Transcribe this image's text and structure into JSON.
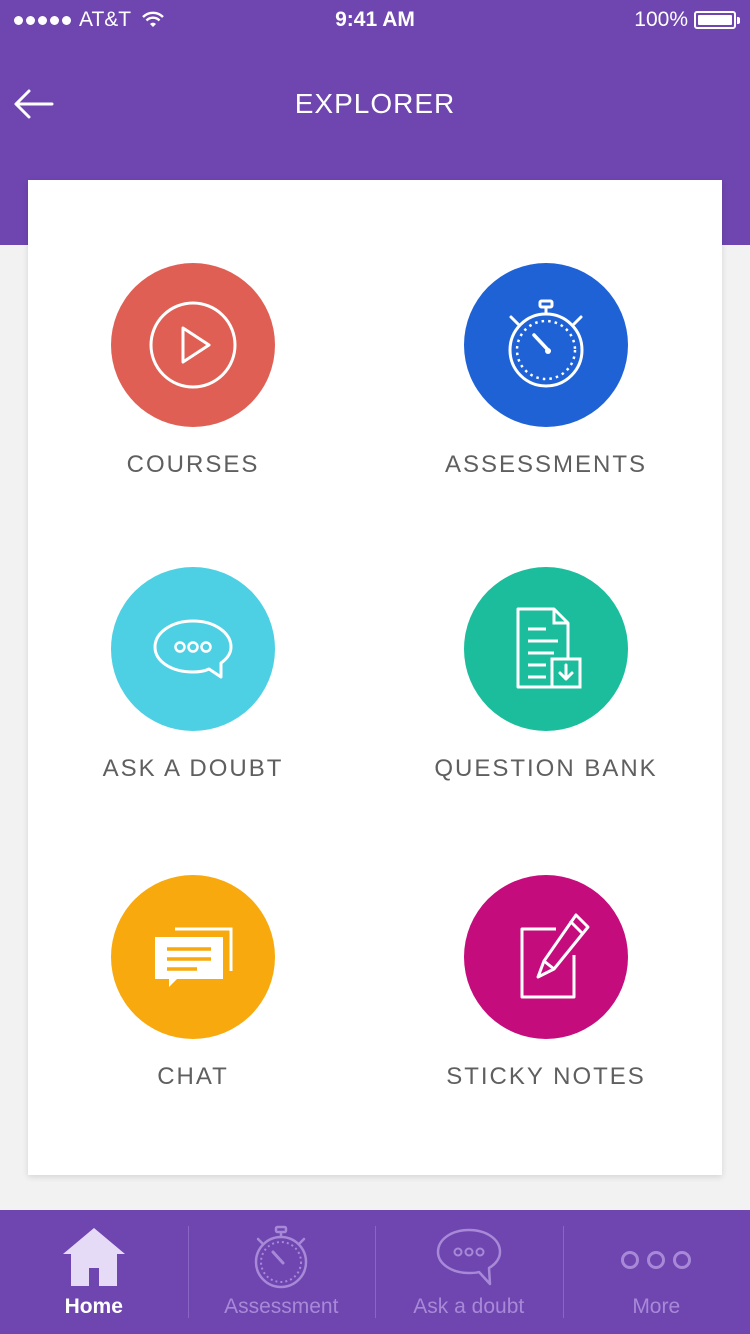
{
  "status_bar": {
    "carrier": "AT&T",
    "time": "9:41 AM",
    "battery": "100%"
  },
  "header": {
    "title": "EXPLORER",
    "back_icon": "arrow-left-icon"
  },
  "tiles": [
    {
      "label": "COURSES",
      "color": "#e05f54",
      "icon": "play-circle-icon"
    },
    {
      "label": "ASSESSMENTS",
      "color": "#1e62d6",
      "icon": "stopwatch-icon"
    },
    {
      "label": "ASK A DOUBT",
      "color": "#4dd0e3",
      "icon": "speech-bubble-icon"
    },
    {
      "label": "QUESTION BANK",
      "color": "#1bbd9c",
      "icon": "document-download-icon"
    },
    {
      "label": "CHAT",
      "color": "#f7a90e",
      "icon": "chat-messages-icon"
    },
    {
      "label": "STICKY NOTES",
      "color": "#c40c7c",
      "icon": "note-pencil-icon"
    }
  ],
  "bottom_nav": [
    {
      "label": "Home",
      "icon": "home-icon",
      "active": true
    },
    {
      "label": "Assessment",
      "icon": "stopwatch-icon",
      "active": false
    },
    {
      "label": "Ask a doubt",
      "icon": "speech-bubble-icon",
      "active": false
    },
    {
      "label": "More",
      "icon": "more-dots-icon",
      "active": false
    }
  ],
  "colors": {
    "primary": "#6f45b0",
    "inactive_nav": "#a889d8",
    "label_text": "#5f5f5f"
  }
}
